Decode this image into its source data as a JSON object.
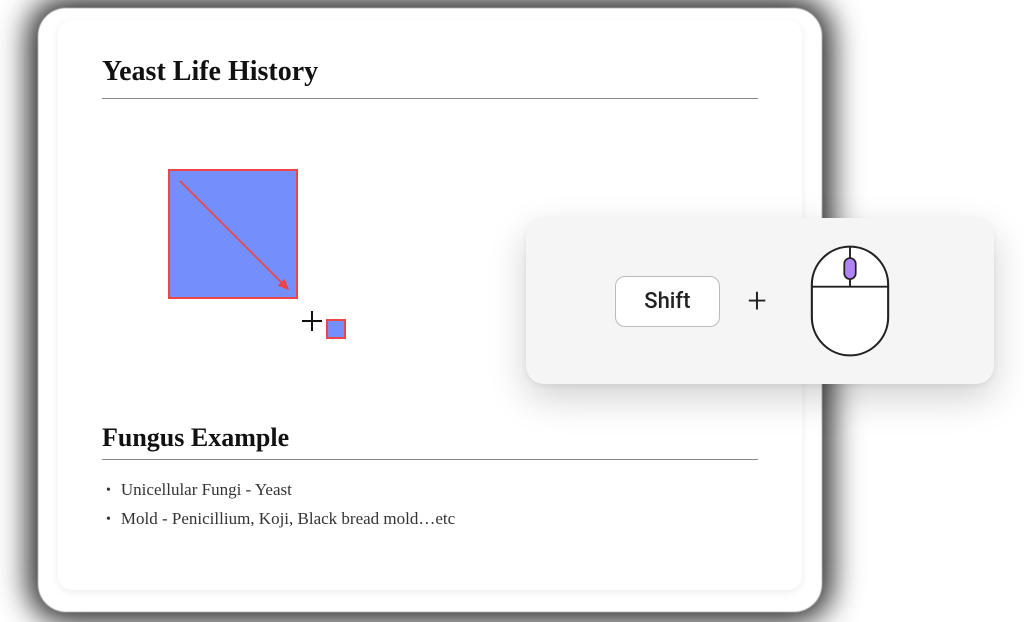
{
  "headings": {
    "title1": "Yeast Life History",
    "title2": "Fungus Example"
  },
  "bullets": {
    "item1": "Unicellular Fungi - Yeast",
    "item2": "Mold - Penicillium, Koji, Black bread mold…etc"
  },
  "hint": {
    "key_label": "Shift",
    "plus_glyph": "+"
  },
  "shapes": {
    "fill_color": "#748efc",
    "stroke_color": "#ef4444"
  },
  "mouse_accent_color": "#b084f4"
}
